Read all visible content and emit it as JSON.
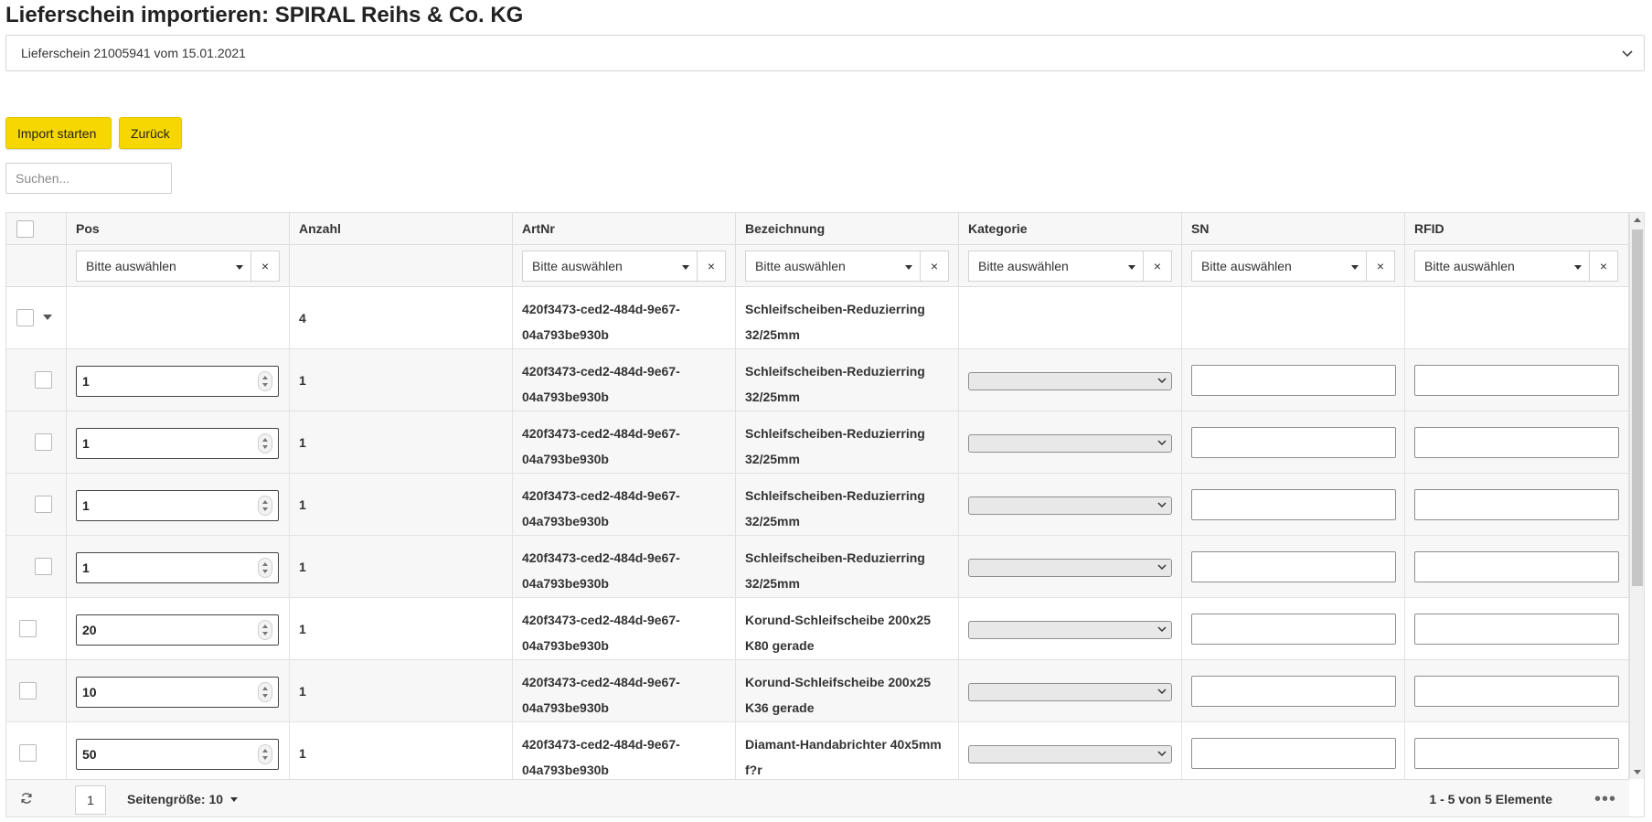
{
  "title": "Lieferschein importieren: SPIRAL Reihs & Co. KG",
  "delivery_select": {
    "value": "Lieferschein 21005941 vom 15.01.2021"
  },
  "buttons": {
    "import": "Import starten",
    "back": "Zurück"
  },
  "search": {
    "placeholder": "Suchen..."
  },
  "columns": {
    "pos": "Pos",
    "anzahl": "Anzahl",
    "artnr": "ArtNr",
    "bezeichnung": "Bezeichnung",
    "kategorie": "Kategorie",
    "sn": "SN",
    "rfid": "RFID"
  },
  "filters": {
    "placeholder": "Bitte auswählen",
    "clear": "×"
  },
  "group_row": {
    "anzahl": "4",
    "artnr": "420f3473-ced2-484d-9e67-04a793be930b",
    "bezeichnung": "Schleifscheiben-Reduzierring 32/25mm"
  },
  "rows": [
    {
      "pos": "1",
      "anzahl": "1",
      "artnr": "420f3473-ced2-484d-9e67-04a793be930b",
      "bezeichnung": "Schleifscheiben-Reduzierring 32/25mm"
    },
    {
      "pos": "1",
      "anzahl": "1",
      "artnr": "420f3473-ced2-484d-9e67-04a793be930b",
      "bezeichnung": "Schleifscheiben-Reduzierring 32/25mm"
    },
    {
      "pos": "1",
      "anzahl": "1",
      "artnr": "420f3473-ced2-484d-9e67-04a793be930b",
      "bezeichnung": "Schleifscheiben-Reduzierring 32/25mm"
    },
    {
      "pos": "1",
      "anzahl": "1",
      "artnr": "420f3473-ced2-484d-9e67-04a793be930b",
      "bezeichnung": "Schleifscheiben-Reduzierring 32/25mm"
    },
    {
      "pos": "20",
      "anzahl": "1",
      "artnr": "420f3473-ced2-484d-9e67-04a793be930b",
      "bezeichnung": "Korund-Schleifscheibe 200x25 K80 gerade"
    },
    {
      "pos": "10",
      "anzahl": "1",
      "artnr": "420f3473-ced2-484d-9e67-04a793be930b",
      "bezeichnung": "Korund-Schleifscheibe 200x25 K36 gerade"
    },
    {
      "pos": "50",
      "anzahl": "1",
      "artnr": "420f3473-ced2-484d-9e67-04a793be930b",
      "bezeichnung": "Diamant-Handabrichter 40x5mm f?r"
    }
  ],
  "footer": {
    "page": "1",
    "page_size": "Seitengröße: 10",
    "info": "1 - 5 von 5 Elemente",
    "more": "•••"
  },
  "colors": {
    "accent": "#f7d700",
    "header_bg": "#f7f7f7"
  },
  "icons": [
    "chevron-down-icon",
    "refresh-icon",
    "more-icon",
    "caret-down-icon",
    "spinner-icon"
  ]
}
